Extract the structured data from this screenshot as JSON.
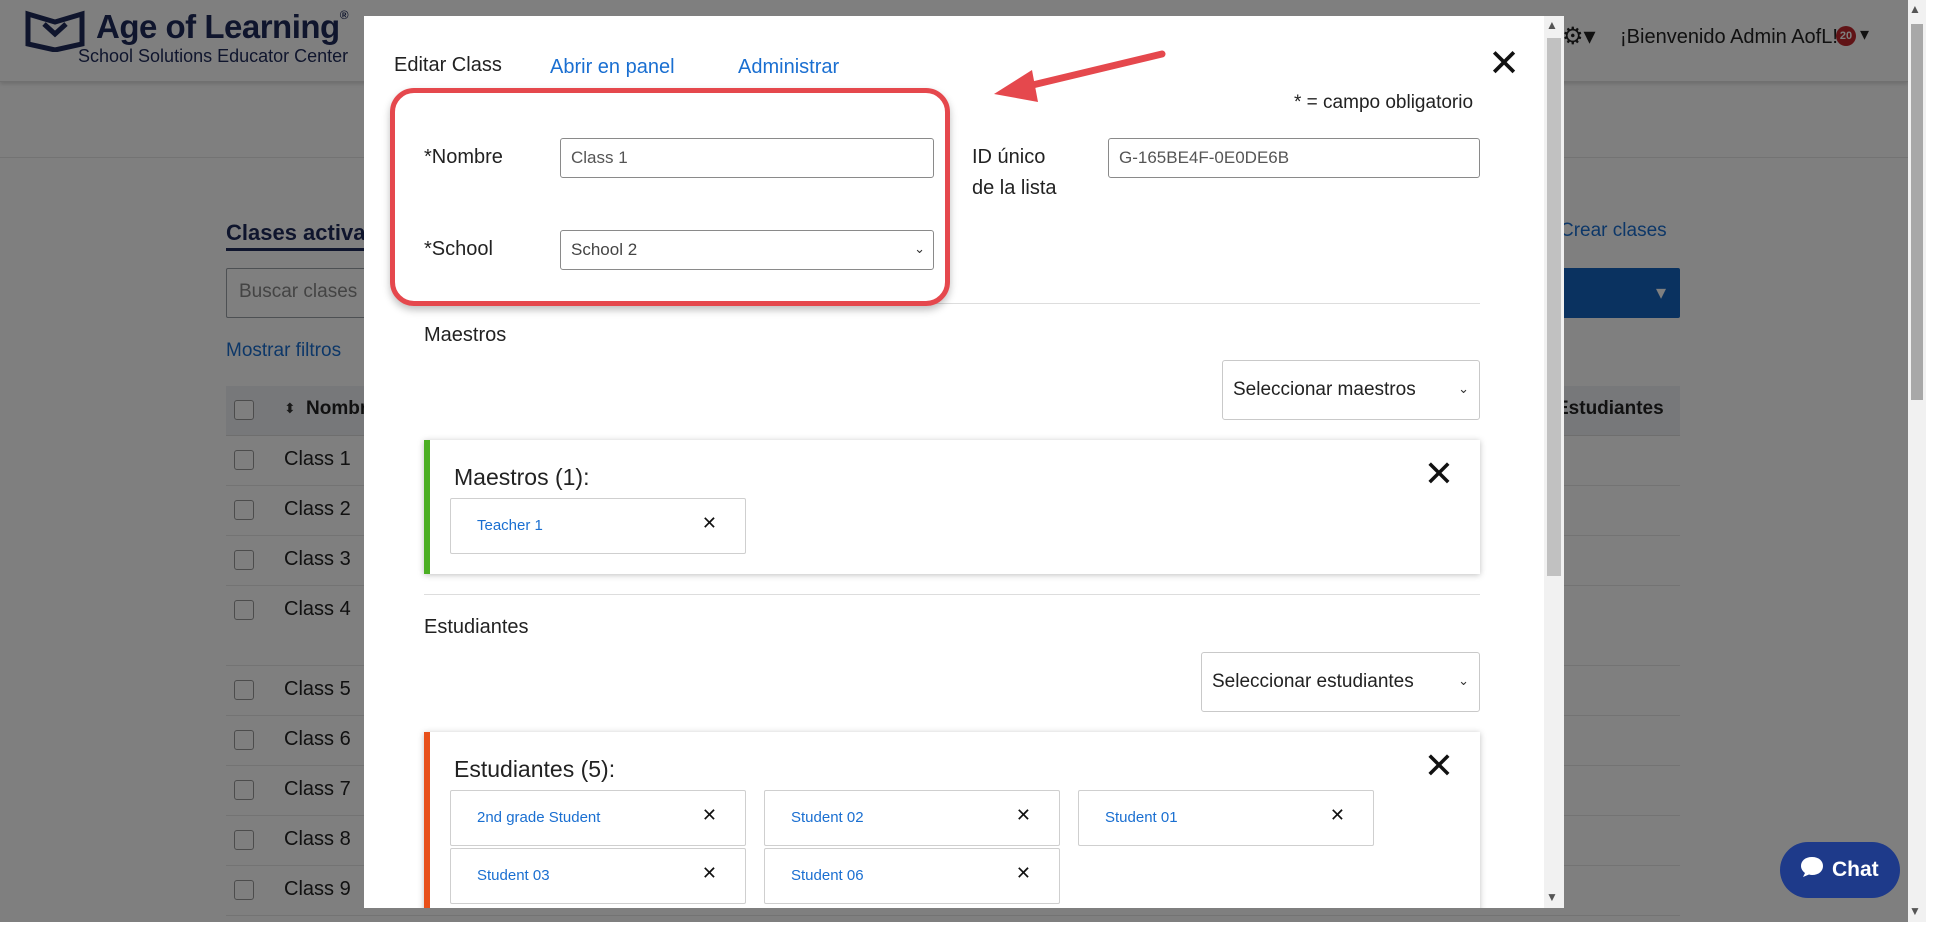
{
  "header": {
    "brand": "Age of Learning",
    "brand_registered": "®",
    "subtitle": "School Solutions Educator Center",
    "welcome": "¡Bienvenido Admin AofL!",
    "notification_count": "20"
  },
  "classes_page": {
    "title": "Clases activas",
    "create_link": "Crear clases",
    "search_placeholder": "Buscar clases",
    "show_filters": "Mostrar filtros",
    "columns": {
      "name": "Nombre",
      "students": "Estudiantes"
    },
    "rows": [
      "Class 1",
      "Class 2",
      "Class 3",
      "Class 4",
      "Class 5",
      "Class 6",
      "Class 7",
      "Class 8",
      "Class 9"
    ]
  },
  "modal": {
    "title": "Editar Class",
    "link_panel": "Abrir en panel",
    "link_admin": "Administrar",
    "required_note": "* = campo obligatorio",
    "name_label": "*Nombre",
    "name_value": "Class 1",
    "school_label": "*School",
    "school_value": "School 2",
    "id_label_1": "ID único",
    "id_label_2": "de la lista",
    "id_value": "G-165BE4F-0E0DE6B",
    "teachers_section": "Maestros",
    "teachers_select": "Seleccionar maestros",
    "teachers_panel_title": "Maestros (1):",
    "teachers": [
      "Teacher 1"
    ],
    "students_section": "Estudiantes",
    "students_select": "Seleccionar estudiantes",
    "students_panel_title": "Estudiantes (5):",
    "students": [
      "2nd grade Student",
      "Student 02",
      "Student 01",
      "Student 03",
      "Student 06"
    ]
  },
  "chat": {
    "label": "Chat"
  },
  "colors": {
    "brand_navy": "#1e2a5a",
    "link_blue": "#1a6fd1",
    "highlight_red": "#e5484d",
    "teacher_accent": "#4caf24",
    "student_accent": "#e8501a",
    "chat_bg": "#1e3a8a"
  }
}
